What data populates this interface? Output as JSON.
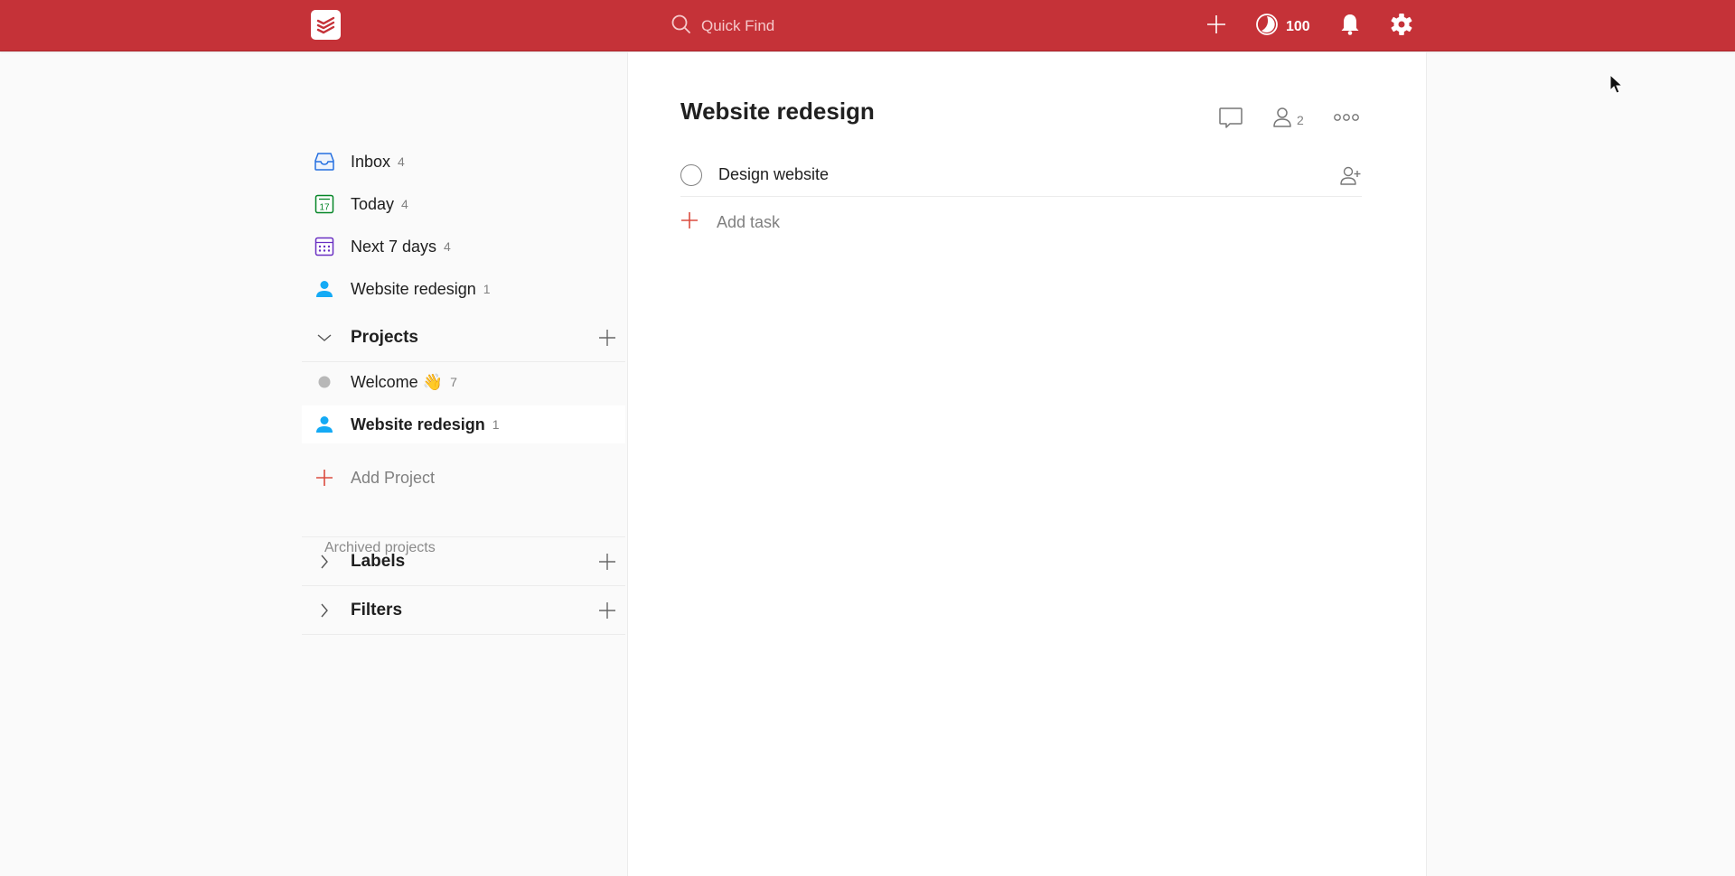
{
  "topbar": {
    "logo": "todoist-logo-icon",
    "search_placeholder": "Quick Find",
    "karma_value": "100",
    "colors": {
      "bar": "#c53238"
    }
  },
  "sidebar": {
    "nav_items": [
      {
        "label": "Inbox",
        "count": "4",
        "icon": "inbox-icon",
        "color": "#246fe0"
      },
      {
        "label": "Today",
        "count": "4",
        "icon": "calendar-today-icon",
        "color": "#058527"
      },
      {
        "label": "Next 7 days",
        "count": "4",
        "icon": "calendar-week-icon",
        "color": "#692fc2"
      },
      {
        "label": "Website redesign",
        "count": "1",
        "icon": "shared-person-icon",
        "color": "#14aaf5"
      }
    ],
    "projects_section": {
      "title": "Projects",
      "items": [
        {
          "label": "Welcome 👋",
          "count": "7",
          "icon": "gray-dot-icon",
          "active": false
        },
        {
          "label": "Website redesign",
          "count": "1",
          "icon": "shared-person-icon",
          "active": true
        }
      ],
      "add_label": "Add Project",
      "archived_label": "Archived projects"
    },
    "labels_section": {
      "title": "Labels"
    },
    "filters_section": {
      "title": "Filters"
    }
  },
  "main": {
    "title": "Website redesign",
    "collaborator_count": "2",
    "tasks": [
      {
        "text": "Design website",
        "completed": false
      }
    ],
    "add_task_label": "Add task"
  }
}
